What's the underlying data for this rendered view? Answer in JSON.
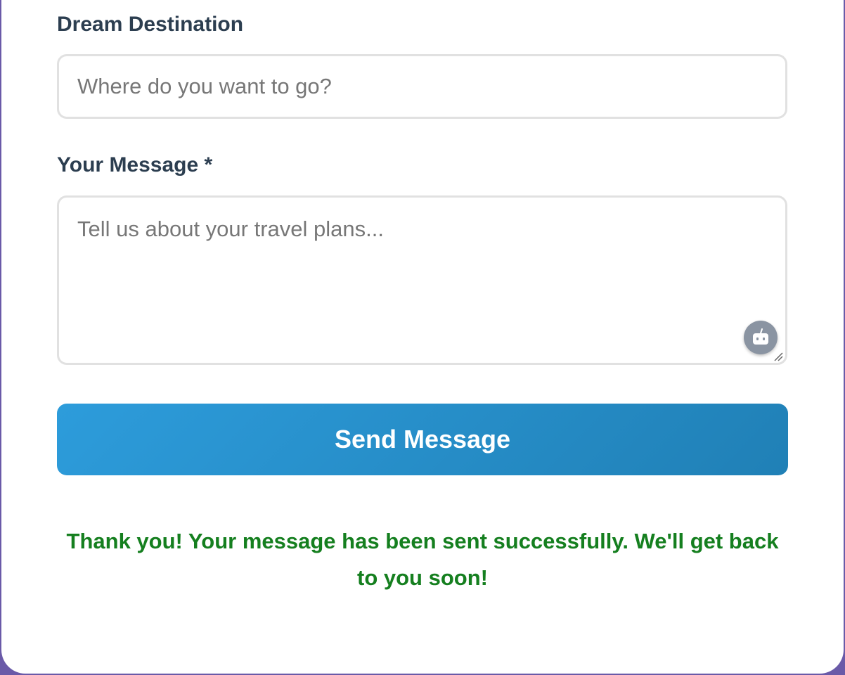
{
  "form": {
    "destination": {
      "label": "Dream Destination",
      "placeholder": "Where do you want to go?",
      "value": ""
    },
    "message": {
      "label": "Your Message *",
      "placeholder": "Tell us about your travel plans...",
      "value": ""
    },
    "submit_label": "Send Message",
    "success_message": "Thank you! Your message has been sent successfully. We'll get back to you soon!"
  },
  "icons": {
    "assistant": "robot-icon",
    "resize": "resize-grip-icon"
  },
  "colors": {
    "page_background": "#6a5aa8",
    "label": "#2c3e50",
    "button_start": "#2d9cdb",
    "button_end": "#2080b6",
    "success": "#157f1f"
  }
}
